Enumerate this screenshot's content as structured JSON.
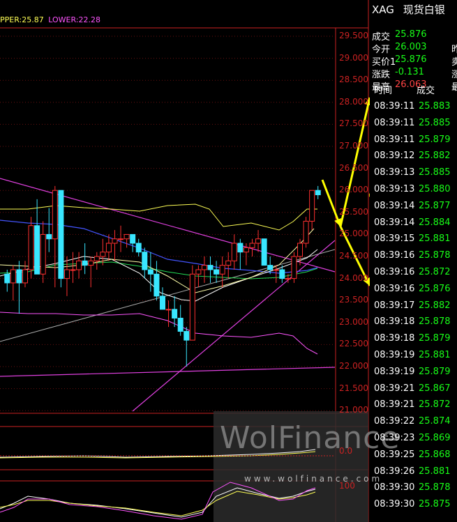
{
  "legend": {
    "upper": "PPER:25.87",
    "lower": "LOWER:22.28"
  },
  "price_axis": [
    "29.500",
    "29.000",
    "28.500",
    "28.000",
    "27.500",
    "27.000",
    "26.500",
    "26.000",
    "25.500",
    "25.000",
    "24.500",
    "24.000",
    "23.500",
    "23.000",
    "22.500",
    "22.000",
    "21.500",
    "21.000"
  ],
  "macd_axis": [
    "0.0"
  ],
  "kdj_axis": [
    "100"
  ],
  "quote": {
    "code": "XAG",
    "name": "现货白银",
    "rows": [
      {
        "label": "成交",
        "value": "25.876",
        "color": "#18ff18",
        "extra": ""
      },
      {
        "label": "今开",
        "value": "26.003",
        "color": "#18ff18",
        "extra": "昨"
      },
      {
        "label": "买价1",
        "value": "25.876",
        "color": "#18ff18",
        "extra": "卖"
      },
      {
        "label": "涨跌",
        "value": "-0.131",
        "color": "#18ff18",
        "extra": "涨"
      },
      {
        "label": "最高",
        "value": "26.063",
        "color": "#ff4444",
        "extra": "最"
      }
    ]
  },
  "trades": {
    "headers": [
      "时间",
      "成交"
    ],
    "rows": [
      {
        "time": "08:39:11",
        "price": "25.883"
      },
      {
        "time": "08:39:11",
        "price": "25.885"
      },
      {
        "time": "08:39:11",
        "price": "25.879"
      },
      {
        "time": "08:39:12",
        "price": "25.882"
      },
      {
        "time": "08:39:13",
        "price": "25.885"
      },
      {
        "time": "08:39:13",
        "price": "25.880"
      },
      {
        "time": "08:39:14",
        "price": "25.877"
      },
      {
        "time": "08:39:14",
        "price": "25.884"
      },
      {
        "time": "08:39:15",
        "price": "25.881"
      },
      {
        "time": "08:39:16",
        "price": "25.878"
      },
      {
        "time": "08:39:16",
        "price": "25.872"
      },
      {
        "time": "08:39:16",
        "price": "25.876"
      },
      {
        "time": "08:39:17",
        "price": "25.882"
      },
      {
        "time": "08:39:18",
        "price": "25.878"
      },
      {
        "time": "08:39:18",
        "price": "25.879"
      },
      {
        "time": "08:39:19",
        "price": "25.881"
      },
      {
        "time": "08:39:19",
        "price": "25.879"
      },
      {
        "time": "08:39:21",
        "price": "25.867"
      },
      {
        "time": "08:39:21",
        "price": "25.872"
      },
      {
        "time": "08:39:22",
        "price": "25.874"
      },
      {
        "time": "08:39:23",
        "price": "25.869"
      },
      {
        "time": "08:39:25",
        "price": "25.868"
      },
      {
        "time": "08:39:26",
        "price": "25.881"
      },
      {
        "time": "08:39:30",
        "price": "25.878"
      },
      {
        "time": "08:39:30",
        "price": "25.875"
      }
    ]
  },
  "watermark": {
    "logo": "WolFinance",
    "url": "www.wolfinance.com"
  },
  "colors": {
    "up": "#ff3030",
    "down": "#39e6ff",
    "grid": "#6a1010",
    "upper_band": "#ffff55",
    "lower_band": "#ff55ff",
    "arrows": "#ffff00"
  },
  "chart_data": {
    "type": "candlestick",
    "ylim": [
      21.0,
      29.5
    ],
    "ohlc": [
      [
        24.1,
        24.2,
        23.7,
        23.9
      ],
      [
        23.9,
        24.3,
        23.5,
        24.2
      ],
      [
        24.2,
        24.4,
        23.2,
        23.9
      ],
      [
        23.9,
        24.4,
        23.8,
        24.2
      ],
      [
        24.2,
        25.4,
        24.0,
        25.2
      ],
      [
        25.2,
        25.8,
        24.1,
        24.1
      ],
      [
        24.1,
        25.3,
        23.9,
        25.0
      ],
      [
        25.0,
        25.6,
        24.6,
        24.9
      ],
      [
        24.9,
        26.1,
        23.8,
        26.0
      ],
      [
        26.0,
        26.0,
        23.8,
        24.0
      ],
      [
        24.0,
        24.5,
        23.6,
        24.2
      ],
      [
        24.2,
        24.6,
        23.9,
        24.2
      ],
      [
        24.2,
        24.6,
        24.0,
        24.4
      ],
      [
        24.4,
        24.8,
        24.1,
        24.3
      ],
      [
        24.3,
        24.5,
        23.8,
        24.4
      ],
      [
        24.4,
        24.6,
        24.2,
        24.5
      ],
      [
        24.5,
        24.9,
        24.3,
        24.6
      ],
      [
        24.6,
        25.0,
        24.4,
        24.8
      ],
      [
        24.8,
        25.1,
        24.4,
        24.9
      ],
      [
        24.9,
        25.2,
        24.6,
        24.9
      ],
      [
        24.9,
        25.0,
        24.7,
        25.0
      ],
      [
        25.0,
        25.0,
        24.6,
        24.8
      ],
      [
        24.8,
        24.9,
        24.5,
        24.6
      ],
      [
        24.6,
        24.7,
        24.0,
        24.2
      ],
      [
        24.2,
        24.6,
        23.7,
        24.1
      ],
      [
        24.1,
        24.4,
        23.5,
        23.6
      ],
      [
        23.6,
        23.8,
        23.4,
        23.3
      ],
      [
        23.3,
        23.5,
        22.9,
        23.3
      ],
      [
        23.3,
        23.6,
        22.9,
        23.1
      ],
      [
        23.1,
        23.4,
        22.7,
        22.8
      ],
      [
        22.8,
        22.9,
        22.0,
        22.6
      ],
      [
        22.6,
        24.3,
        22.6,
        24.1
      ],
      [
        24.1,
        24.3,
        23.8,
        24.2
      ],
      [
        24.2,
        24.5,
        23.9,
        24.3
      ],
      [
        24.3,
        24.5,
        23.9,
        24.2
      ],
      [
        24.2,
        24.4,
        23.9,
        24.1
      ],
      [
        24.1,
        24.5,
        23.8,
        24.3
      ],
      [
        24.3,
        24.6,
        24.0,
        24.4
      ],
      [
        24.4,
        25.0,
        24.2,
        24.8
      ],
      [
        24.8,
        24.9,
        24.2,
        24.6
      ],
      [
        24.6,
        24.8,
        24.3,
        24.7
      ],
      [
        24.7,
        24.9,
        24.5,
        24.8
      ],
      [
        24.8,
        25.1,
        24.6,
        24.9
      ],
      [
        24.9,
        24.9,
        24.3,
        24.3
      ],
      [
        24.3,
        24.5,
        24.1,
        24.2
      ],
      [
        24.2,
        24.3,
        23.9,
        24.2
      ],
      [
        24.2,
        24.3,
        23.9,
        24.0
      ],
      [
        24.0,
        24.1,
        23.9,
        24.0
      ],
      [
        24.0,
        24.6,
        23.9,
        24.5
      ],
      [
        24.5,
        24.9,
        24.3,
        24.8
      ],
      [
        24.8,
        25.4,
        24.7,
        25.3
      ],
      [
        25.3,
        25.8,
        25.1,
        26.0
      ],
      [
        26.0,
        26.1,
        25.8,
        25.9
      ]
    ],
    "last_price": 25.876,
    "upper_band_label": "PPER:25.87",
    "lower_band_label": "LOWER:22.28"
  }
}
